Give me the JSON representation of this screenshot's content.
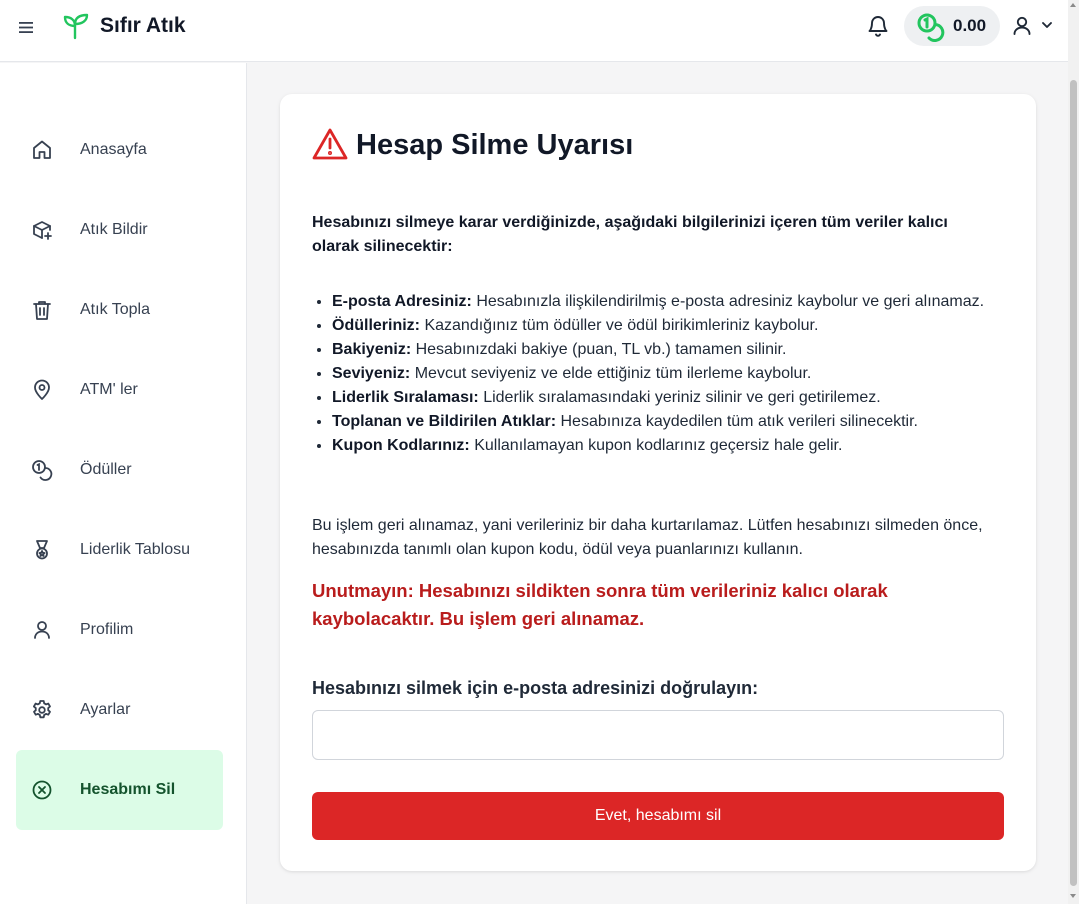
{
  "header": {
    "brand": "Sıfır Atık",
    "balance": "0.00"
  },
  "sidebar": {
    "items": [
      {
        "label": "Anasayfa",
        "icon": "home-icon"
      },
      {
        "label": "Atık Bildir",
        "icon": "box-plus-icon"
      },
      {
        "label": "Atık Topla",
        "icon": "trash-icon"
      },
      {
        "label": "ATM' ler",
        "icon": "map-pin-icon"
      },
      {
        "label": "Ödüller",
        "icon": "coins-icon"
      },
      {
        "label": "Liderlik Tablosu",
        "icon": "medal-icon"
      },
      {
        "label": "Profilim",
        "icon": "user-icon"
      },
      {
        "label": "Ayarlar",
        "icon": "gear-icon"
      },
      {
        "label": "Hesabımı Sil",
        "icon": "x-circle-icon",
        "active": true
      }
    ]
  },
  "main": {
    "title": "Hesap Silme Uyarısı",
    "intro": "Hesabınızı silmeye karar verdiğinizde, aşağıdaki bilgilerinizi içeren tüm veriler kalıcı olarak silinecektir:",
    "items": [
      {
        "term": "E-posta Adresiniz:",
        "text": "Hesabınızla ilişkilendirilmiş e-posta adresiniz kaybolur ve geri alınamaz."
      },
      {
        "term": "Ödülleriniz:",
        "text": "Kazandığınız tüm ödüller ve ödül birikimleriniz kaybolur."
      },
      {
        "term": "Bakiyeniz:",
        "text": "Hesabınızdaki bakiye (puan, TL vb.) tamamen silinir."
      },
      {
        "term": "Seviyeniz:",
        "text": "Mevcut seviyeniz ve elde ettiğiniz tüm ilerleme kaybolur."
      },
      {
        "term": "Liderlik Sıralaması:",
        "text": "Liderlik sıralamasındaki yeriniz silinir ve geri getirilemez."
      },
      {
        "term": "Toplanan ve Bildirilen Atıklar:",
        "text": "Hesabınıza kaydedilen tüm atık verileri silinecektir."
      },
      {
        "term": "Kupon Kodlarınız:",
        "text": "Kullanılamayan kupon kodlarınız geçersiz hale gelir."
      }
    ],
    "note": "Bu işlem geri alınamaz, yani verileriniz bir daha kurtarılamaz. Lütfen hesabınızı silmeden önce, hesabınızda tanımlı olan kupon kodu, ödül veya puanlarınızı kullanın.",
    "reminder_strong": "Unutmayın:",
    "reminder_text": "Hesabınızı sildikten sonra tüm verileriniz kalıcı olarak kaybolacaktır. Bu işlem geri alınamaz.",
    "confirm_label": "Hesabınızı silmek için e-posta adresinizi doğrulayın:",
    "email_value": "",
    "delete_button": "Evet, hesabımı sil"
  },
  "colors": {
    "accent_green": "#22c55e",
    "active_bg": "#dcfce7",
    "danger": "#dc2626",
    "danger_text": "#b91c1c"
  }
}
